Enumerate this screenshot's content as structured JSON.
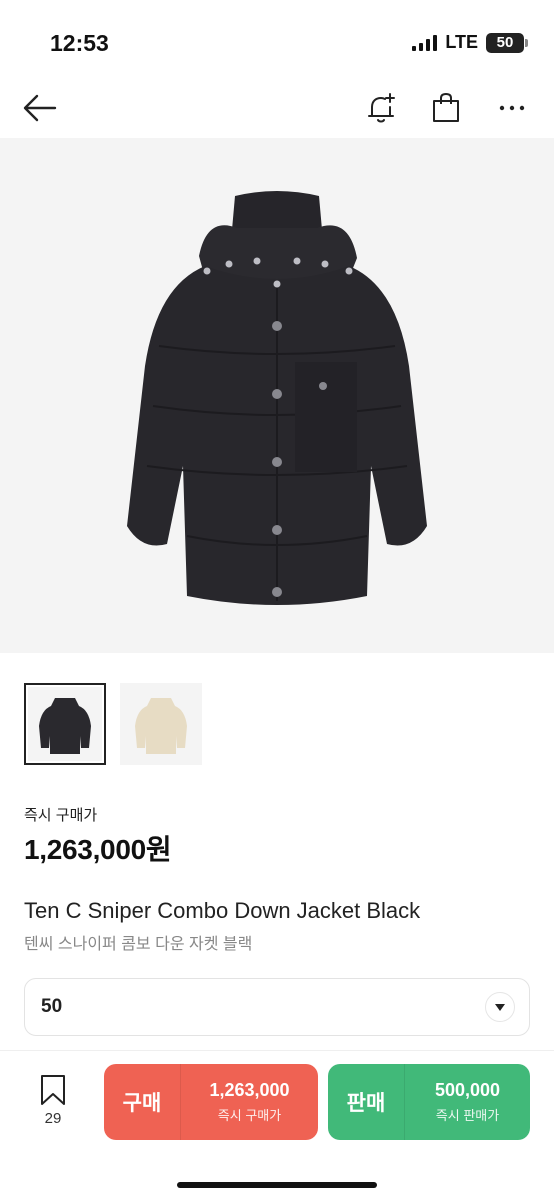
{
  "status_bar": {
    "time": "12:53",
    "network": "LTE",
    "battery": "50",
    "icons": [
      "signal-icon",
      "battery-icon"
    ]
  },
  "nav": {
    "icons": [
      "back-arrow-icon",
      "bell-plus-icon",
      "shopping-bag-icon",
      "more-icon"
    ]
  },
  "product": {
    "thumbnails": [
      {
        "color_name": "black",
        "icon": "black-jacket-thumbnail"
      },
      {
        "color_name": "beige",
        "icon": "beige-jacket-thumbnail"
      }
    ],
    "price_label": "즉시 구매가",
    "price": "1,263,000원",
    "name": "Ten C Sniper Combo Down Jacket Black",
    "name_ko": "텐씨 스나이퍼 콤보 다운 자켓 블랙"
  },
  "size_select": {
    "value": "50",
    "icon": "caret-down-icon"
  },
  "bottom_bar": {
    "wish_count": "29",
    "buy": {
      "label": "구매",
      "price": "1,263,000",
      "caption": "즉시 구매가"
    },
    "sell": {
      "label": "판매",
      "price": "500,000",
      "caption": "즉시 판매가"
    }
  },
  "colors": {
    "buy_accent": "#ef6253",
    "sell_accent": "#41b979",
    "text_primary": "#222222",
    "text_secondary": "#888888"
  }
}
